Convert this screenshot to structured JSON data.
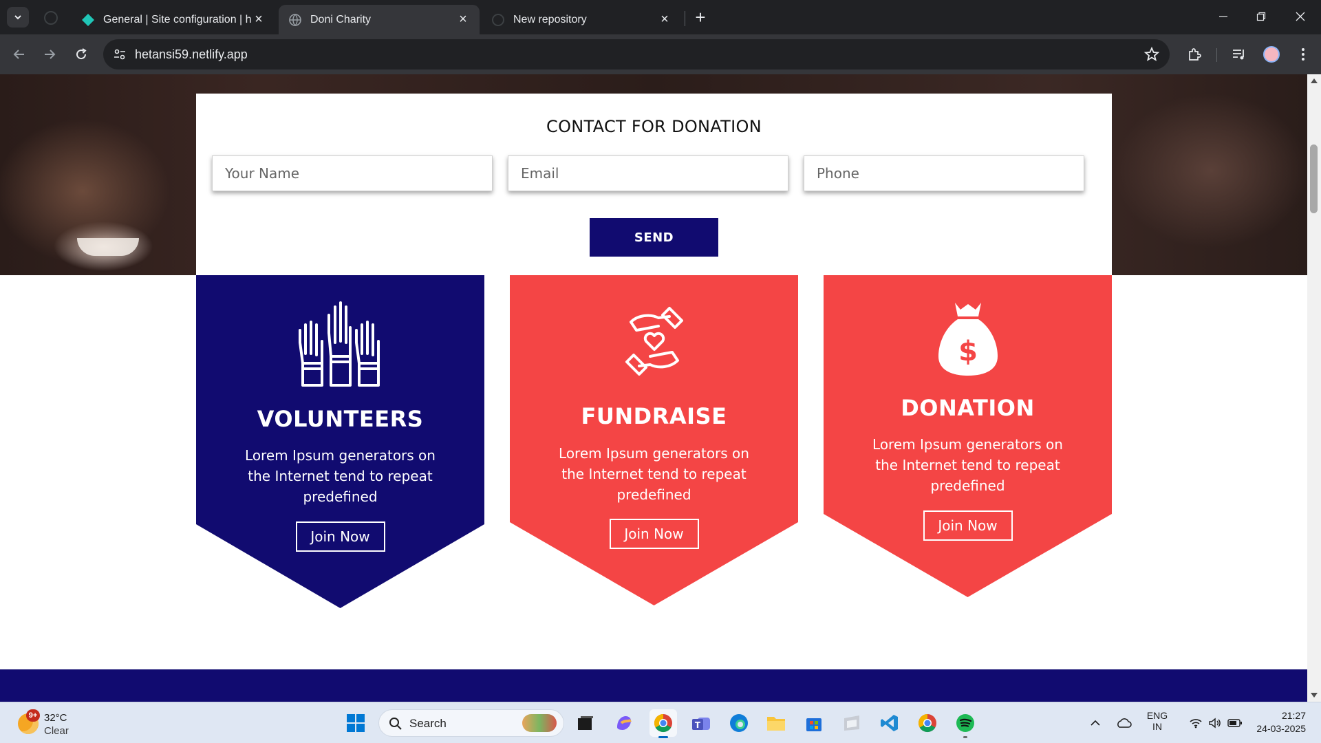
{
  "browser": {
    "tabs": [
      {
        "title": "General | Site configuration | he",
        "active": false
      },
      {
        "title": "Doni Charity",
        "active": true
      },
      {
        "title": "New repository",
        "active": false
      }
    ],
    "url": "hetansi59.netlify.app"
  },
  "page": {
    "contact": {
      "heading": "CONTACT FOR DONATION",
      "name_placeholder": "Your Name",
      "email_placeholder": "Email",
      "phone_placeholder": "Phone",
      "send_label": "SEND"
    },
    "cards": [
      {
        "title": "VOLUNTEERS",
        "text": "Lorem Ipsum generators on the Internet tend to repeat predefined",
        "button": "Join Now",
        "color": "#110b70",
        "icon": "raised-hands-icon"
      },
      {
        "title": "FUNDRAISE",
        "text": "Lorem Ipsum generators on the Internet tend to repeat predefined",
        "button": "Join Now",
        "color": "#f44545",
        "icon": "hands-heart-icon"
      },
      {
        "title": "DONATION",
        "text": "Lorem Ipsum generators on the Internet tend to repeat predefined",
        "button": "Join Now",
        "color": "#f44545",
        "icon": "money-bag-icon"
      }
    ],
    "footer_color": "#110b70"
  },
  "taskbar": {
    "weather": {
      "badge": "9+",
      "temp": "32°C",
      "condition": "Clear"
    },
    "search_label": "Search",
    "language": {
      "line1": "ENG",
      "line2": "IN"
    },
    "clock": {
      "time": "21:27",
      "date": "24-03-2025"
    }
  }
}
